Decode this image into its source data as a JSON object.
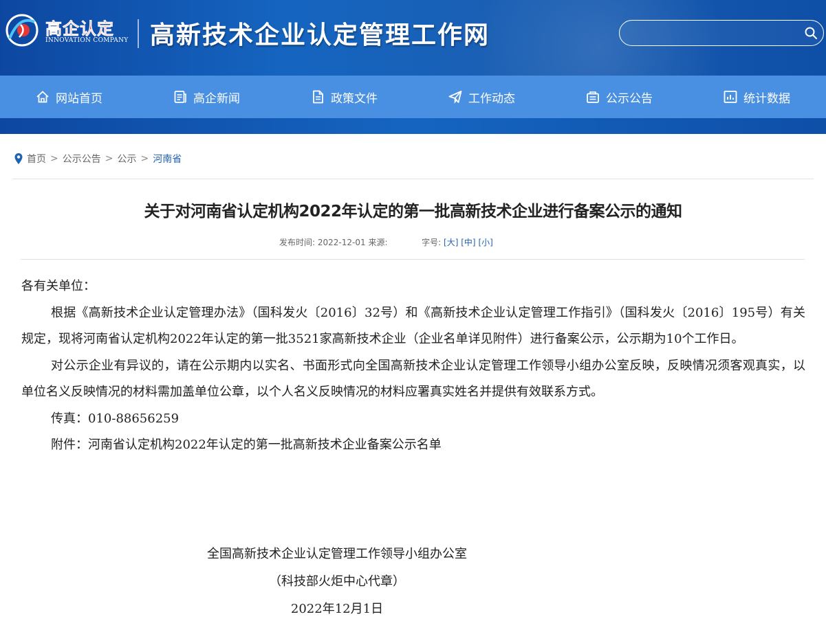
{
  "header": {
    "logo_text": "高企认定",
    "logo_subtext": "INNOVATION COMPANY",
    "site_title": "高新技术企业认定管理工作网",
    "search_placeholder": ""
  },
  "nav": {
    "items": [
      {
        "label": "网站首页",
        "icon": "home-icon"
      },
      {
        "label": "高企新闻",
        "icon": "news-icon"
      },
      {
        "label": "政策文件",
        "icon": "document-icon"
      },
      {
        "label": "工作动态",
        "icon": "paper-plane-icon"
      },
      {
        "label": "公示公告",
        "icon": "announcement-icon"
      },
      {
        "label": "统计数据",
        "icon": "chart-icon"
      }
    ]
  },
  "breadcrumb": {
    "items": [
      "首页",
      "公示公告",
      "公示",
      "河南省"
    ],
    "separator": ">"
  },
  "article": {
    "title": "关于对河南省认定机构2022年认定的第一批高新技术企业进行备案公示的通知",
    "meta": {
      "publish_label": "发布时间:",
      "publish_date": "2022-12-01",
      "source_label": "来源:",
      "source": "",
      "font_size_label": "字号:",
      "font_sizes": [
        "[大]",
        "[中]",
        "[小]"
      ]
    },
    "salutation": "各有关单位：",
    "paragraphs": [
      "根据《高新技术企业认定管理办法》（国科发火〔2016〕32号）和《高新技术企业认定管理工作指引》（国科发火〔2016〕195号）有关规定，现将河南省认定机构2022年认定的第一批3521家高新技术企业（企业名单详见附件）进行备案公示，公示期为10个工作日。",
      "对公示企业有异议的，请在公示期内以实名、书面形式向全国高新技术企业认定管理工作领导小组办公室反映，反映情况须客观真实，以单位名义反映情况的材料需加盖单位公章，以个人名义反映情况的材料应署真实姓名并提供有效联系方式。"
    ],
    "fax": "传真：010-88656259",
    "attachment": "附件：河南省认定机构2022年认定的第一批高新技术企业备案公示名单",
    "signature": {
      "org": "全国高新技术企业认定管理工作领导小组办公室",
      "seal": "（科技部火炬中心代章）",
      "date": "2022年12月1日"
    }
  },
  "colors": {
    "header_blue": "#1565c0",
    "nav_blue": "#4a90e2",
    "link_blue": "#1e62b4",
    "logo_red": "#e53935"
  }
}
